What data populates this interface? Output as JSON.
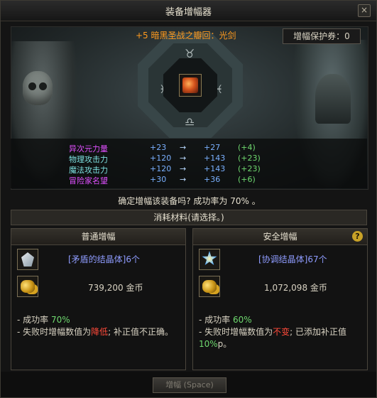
{
  "window": {
    "title": "装备增幅器",
    "close": "×"
  },
  "item": {
    "name": "+5 暗黑圣战之瓣回：光剑"
  },
  "protection": {
    "label": "增幅保护券：0"
  },
  "stats": [
    {
      "name": "异次元力量",
      "from": "+23",
      "arrow": "→",
      "to": "+27",
      "delta": "(+4)",
      "color": "#e050ff"
    },
    {
      "name": "物理攻击力",
      "from": "+120",
      "arrow": "→",
      "to": "+143",
      "delta": "(+23)",
      "color": "#7de0e0"
    },
    {
      "name": "魔法攻击力",
      "from": "+120",
      "arrow": "→",
      "to": "+143",
      "delta": "(+23)",
      "color": "#7de0e0"
    },
    {
      "name": "冒险家名望",
      "from": "+30",
      "arrow": "→",
      "to": "+36",
      "delta": "(+6)",
      "color": "#e050ff"
    }
  ],
  "confirm_text": "确定增幅该装备吗? 成功率为 70% 。",
  "materials_title": "消耗材料(请选择。)",
  "normal": {
    "title": "普通增幅",
    "material": "[矛盾的结晶体]6个",
    "gold": "739,200 金币",
    "rate_prefix": "- 成功率 ",
    "rate": "70%",
    "fail_prefix": "- 失败时增幅数值为",
    "fail_value": "降低",
    "fail_suffix": "; 补正值不正确。"
  },
  "safe": {
    "title": "安全增幅",
    "help": "?",
    "material": "[协调结晶体]67个",
    "gold": "1,072,098 金币",
    "rate_prefix": "- 成功率 ",
    "rate": "60%",
    "fail_prefix": "- 失败时增幅数值为",
    "fail_value": "不变",
    "fail_suffix": "; 已添加补正值",
    "bonus": "10%",
    "bonus_suffix": "p。"
  },
  "button": {
    "label": "增幅 (Space)"
  },
  "colors": {
    "item_name": "#ff9a1e",
    "success": "#6fd96f",
    "danger": "#ff4a3a",
    "material": "#8f9cff"
  }
}
